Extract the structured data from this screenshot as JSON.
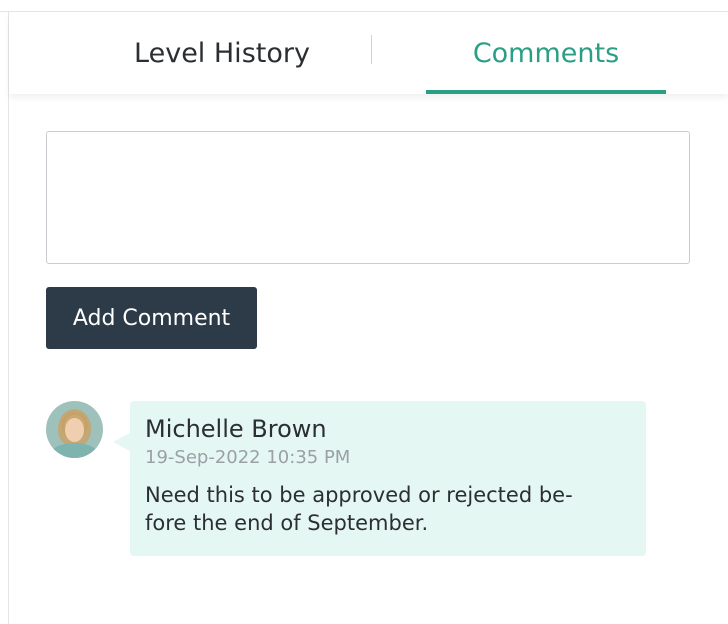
{
  "tabs": {
    "level_history": "Level History",
    "comments": "Comments",
    "active": "Comments"
  },
  "comment_input": {
    "value": "",
    "placeholder": ""
  },
  "add_comment_button": "Add Comment",
  "comments": [
    {
      "author": "Michelle Brown",
      "timestamp": "19-Sep-2022 10:35 PM",
      "text_line_1": "Need this to be approved or rejected be-",
      "text_line_2": "fore the end of September."
    }
  ],
  "colors": {
    "accent": "#2b9f86",
    "button": "#2d3a48",
    "comment_bubble": "#e5f7f3"
  }
}
